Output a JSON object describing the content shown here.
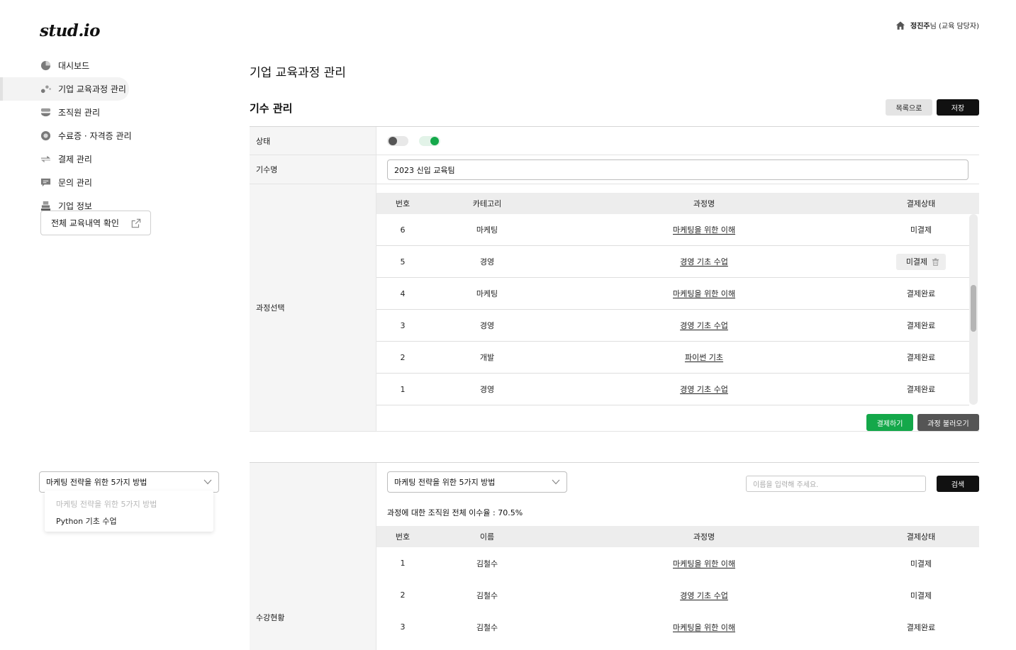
{
  "app": {
    "logo": "stud.io"
  },
  "user": {
    "name": "정진주",
    "suffix": "님 (교육 담당자)"
  },
  "sidebar": {
    "items": [
      {
        "label": "대시보드",
        "icon": "pie-chart-icon"
      },
      {
        "label": "기업 교육과정 관리",
        "icon": "dots-icon",
        "active": true
      },
      {
        "label": "조직원 관리",
        "icon": "group-icon"
      },
      {
        "label": "수료증 · 자격증 관리",
        "icon": "badge-icon"
      },
      {
        "label": "결제 관리",
        "icon": "exchange-icon"
      },
      {
        "label": "문의 관리",
        "icon": "chat-icon"
      },
      {
        "label": "기업 정보",
        "icon": "building-icon"
      }
    ],
    "history_button": "전체 교육내역 확인"
  },
  "page": {
    "title": "기업 교육과정 관리",
    "section_title": "기수 관리"
  },
  "toolbar": {
    "list_label": "목록으로",
    "save_label": "저장"
  },
  "form": {
    "status_label": "상태",
    "cohort_label": "기수명",
    "cohort_value": "2023 신입 교육팀",
    "course_select_label": "과정선택",
    "attendance_label": "수강현황"
  },
  "course_table": {
    "headers": {
      "no": "번호",
      "category": "카테고리",
      "course": "과정명",
      "status": "결제상태"
    },
    "rows": [
      {
        "no": "6",
        "category": "마케팅",
        "course": "마케팅을 위한 이해",
        "status": "미결제"
      },
      {
        "no": "5",
        "category": "경영",
        "course": "경영 기초 수업",
        "status": "미결제"
      },
      {
        "no": "4",
        "category": "마케팅",
        "course": "마케팅을 위한 이해",
        "status": "결제완료"
      },
      {
        "no": "3",
        "category": "경영",
        "course": "경영 기초 수업",
        "status": "결제완료"
      },
      {
        "no": "2",
        "category": "개발",
        "course": "파이썬 기초",
        "status": "결제완료"
      },
      {
        "no": "1",
        "category": "경영",
        "course": "경영 기초 수업",
        "status": "결제완료"
      }
    ],
    "pay_button": "결제하기",
    "load_button": "과정 불러오기"
  },
  "left_select": {
    "value": "마케팅 전략을 위한 5가지 방법",
    "options": [
      "마케팅 전략을 위한 5가지 방법",
      "Python 기초 수업"
    ]
  },
  "attendance": {
    "select_value": "마케팅 전략을 위한 5가지 방법",
    "search_placeholder": "이름을 입력해 주세요.",
    "search_button": "검색",
    "rate_label": "과정에 대한 조직원  전체 이수율 :",
    "rate_value": "70.5%",
    "headers": {
      "no": "번호",
      "name": "이름",
      "course": "과정명",
      "status": "결제상태"
    },
    "rows": [
      {
        "no": "1",
        "name": "김철수",
        "course": "마케팅을 위한 이해",
        "status": "미결제"
      },
      {
        "no": "2",
        "name": "김철수",
        "course": "경영 기초 수업",
        "status": "미결제"
      },
      {
        "no": "3",
        "name": "김철수",
        "course": "마케팅을 위한 이해",
        "status": "결제완료"
      }
    ]
  },
  "colors": {
    "accent_green": "#14a84a",
    "dark": "#111111"
  }
}
